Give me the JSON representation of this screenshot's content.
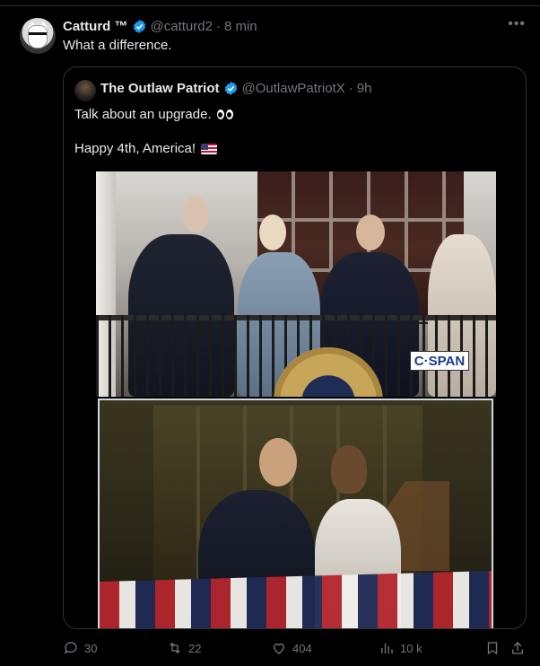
{
  "tweet": {
    "author_name": "Catturd ™",
    "handle": "@catturd2",
    "separator": "·",
    "time": "8 min",
    "text": "What a difference.",
    "more_icon": "more-horizontal-icon"
  },
  "quote": {
    "author_name": "The Outlaw Patriot",
    "handle": "@OutlawPatriotX",
    "separator": "·",
    "time": "9h",
    "line1": "Talk about an upgrade.",
    "line2": "Happy 4th, America!",
    "photo1_watermark": "C·SPAN"
  },
  "actions": {
    "replies": "30",
    "reposts": "22",
    "likes": "404",
    "views": "10 k"
  },
  "colors": {
    "background": "#000000",
    "text": "#e7e9ea",
    "muted": "#71767b",
    "border": "#2f3336",
    "verified": "#1d9bf0"
  }
}
